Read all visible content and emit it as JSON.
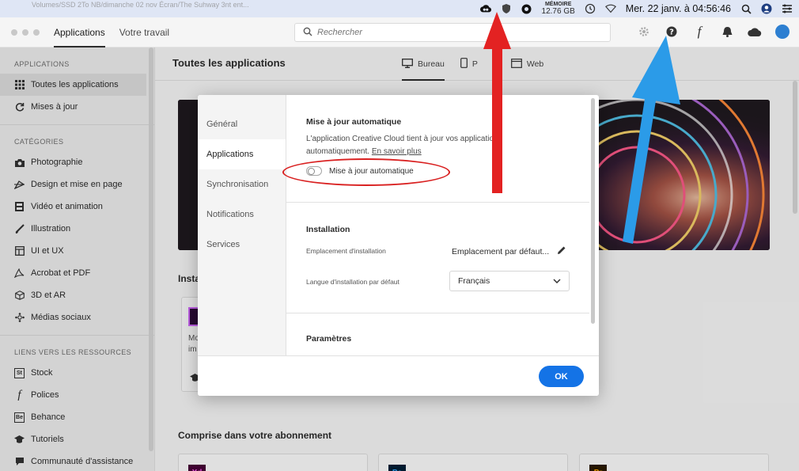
{
  "menubar": {
    "path_text": "Volumes/SSD 2To NB/dimanche 02 nov Écran/The Suhway 3nt ent...",
    "memory_label": "MÉMOIRE",
    "memory_value": "12.76 GB",
    "datetime": "Mer. 22 janv. à 04:56:46"
  },
  "titlebar": {
    "tabs": [
      "Applications",
      "Votre travail"
    ],
    "search_placeholder": "Rechercher",
    "font_icon": "f"
  },
  "sidebar": {
    "section_apps": "APPLICATIONS",
    "apps_items": [
      {
        "label": "Toutes les applications",
        "icon": "grid-icon"
      },
      {
        "label": "Mises à jour",
        "icon": "refresh-icon"
      }
    ],
    "section_categories": "CATÉGORIES",
    "category_items": [
      {
        "label": "Photographie",
        "icon": "camera-icon"
      },
      {
        "label": "Design et mise en page",
        "icon": "pen-tool-icon"
      },
      {
        "label": "Vidéo et animation",
        "icon": "film-icon"
      },
      {
        "label": "Illustration",
        "icon": "brush-icon"
      },
      {
        "label": "UI et UX",
        "icon": "layout-icon"
      },
      {
        "label": "Acrobat et PDF",
        "icon": "acrobat-icon"
      },
      {
        "label": "3D et AR",
        "icon": "cube-icon"
      },
      {
        "label": "Médias sociaux",
        "icon": "social-icon"
      }
    ],
    "section_resources": "LIENS VERS LES RESSOURCES",
    "resource_items": [
      {
        "label": "Stock",
        "icon": "stock-icon",
        "glyph": "St"
      },
      {
        "label": "Polices",
        "icon": "font-icon",
        "glyph": "f"
      },
      {
        "label": "Behance",
        "icon": "behance-icon",
        "glyph": "Be"
      },
      {
        "label": "Tutoriels",
        "icon": "graduation-cap-icon"
      },
      {
        "label": "Communauté d'assistance",
        "icon": "community-icon"
      }
    ]
  },
  "main": {
    "title": "Toutes les applications",
    "view_tabs": [
      "Bureau",
      "P",
      "Web"
    ],
    "installed_label": "Insta",
    "card_text_1": "Mo",
    "card_text_2": "im",
    "subscription_label": "Comprise dans votre abonnement",
    "bottom_card_icons": [
      "Xd",
      "Ps",
      "Pr"
    ]
  },
  "modal": {
    "nav": [
      "Général",
      "Applications",
      "Synchronisation",
      "Notifications",
      "Services"
    ],
    "active_nav": "Applications",
    "auto_update": {
      "title": "Mise à jour automatique",
      "desc_main": "L'application Creative Cloud tient à jour vos applications automatiquement.",
      "desc_link": "En savoir plus",
      "toggle_label": "Mise à jour automatique",
      "toggle_on": false
    },
    "installation": {
      "title": "Installation",
      "location_label": "Emplacement d'installation",
      "location_value": "Emplacement par défaut...",
      "language_label": "Langue d'installation par défaut",
      "language_value": "Français"
    },
    "parameters_title": "Paramètres",
    "ok_label": "OK"
  },
  "annotations": {
    "red_color": "#e32222",
    "blue_color": "#2b9be8",
    "ellipse_color": "#d92020"
  }
}
